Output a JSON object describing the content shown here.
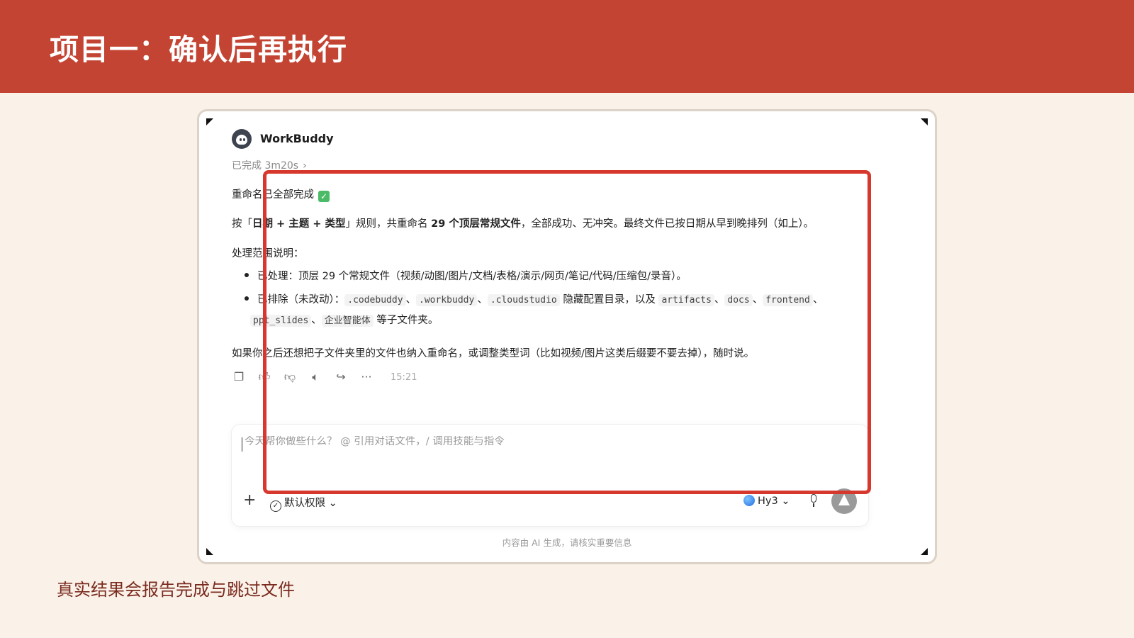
{
  "slide": {
    "title": "项目一：确认后再执行",
    "caption": "真实结果会报告完成与跳过文件",
    "header_color": "#c44433",
    "highlight_color": "#d6382e"
  },
  "app": {
    "name": "WorkBuddy",
    "avatar_icon": "robot-avatar-icon",
    "status": "已完成 3m20s",
    "status_chevron": "›"
  },
  "message": {
    "heading": "重命名已全部完成",
    "heading_badge": "✓",
    "rule_line": {
      "prefix": "按「",
      "rule": "日期 + 主题 + 类型",
      "mid": "」规则，共重命名 ",
      "count": "29 个顶层常规文件",
      "suffix": "，全部成功、无冲突。最终文件已按日期从早到晚排列（如上）。"
    },
    "scope_title": "处理范围说明：",
    "bullet1": "已处理：顶层 29 个常规文件（视频/动图/图片/文档/表格/演示/网页/笔记/代码/压缩包/录音）。",
    "bullet2": {
      "prefix": "已排除（未改动）：",
      "code1": ".codebuddy",
      "sep1": "、",
      "code2": ".workbuddy",
      "sep2": "、",
      "code3": ".cloudstudio",
      "mid": " 隐藏配置目录，以及 ",
      "code4": "artifacts",
      "sep3": "、",
      "code5": "docs",
      "sep4": "、",
      "code6": "frontend",
      "sep5": "、",
      "code7": "ppt_slides",
      "sep6": "、",
      "code8": "企业智能体",
      "suffix": " 等子文件夹。"
    },
    "followup": "如果你之后还想把子文件夹里的文件也纳入重命名，或调整类型词（比如视频/图片这类后缀要不要去掉），随时说。",
    "time": "15:21"
  },
  "actions": {
    "copy": "copy-icon",
    "like": "thumbs-up-icon",
    "dislike": "thumbs-down-icon",
    "speak": "speaker-icon",
    "share": "share-icon",
    "more": "more-icon",
    "more_glyph": "···"
  },
  "composer": {
    "placeholder": "今天帮你做些什么？ @ 引用对话文件，/ 调用技能与指令",
    "plus": "+",
    "permission": "默认权限",
    "model": "Hy3",
    "chevron": "⌄"
  },
  "disclaimer": "内容由 AI 生成，请核实重要信息"
}
